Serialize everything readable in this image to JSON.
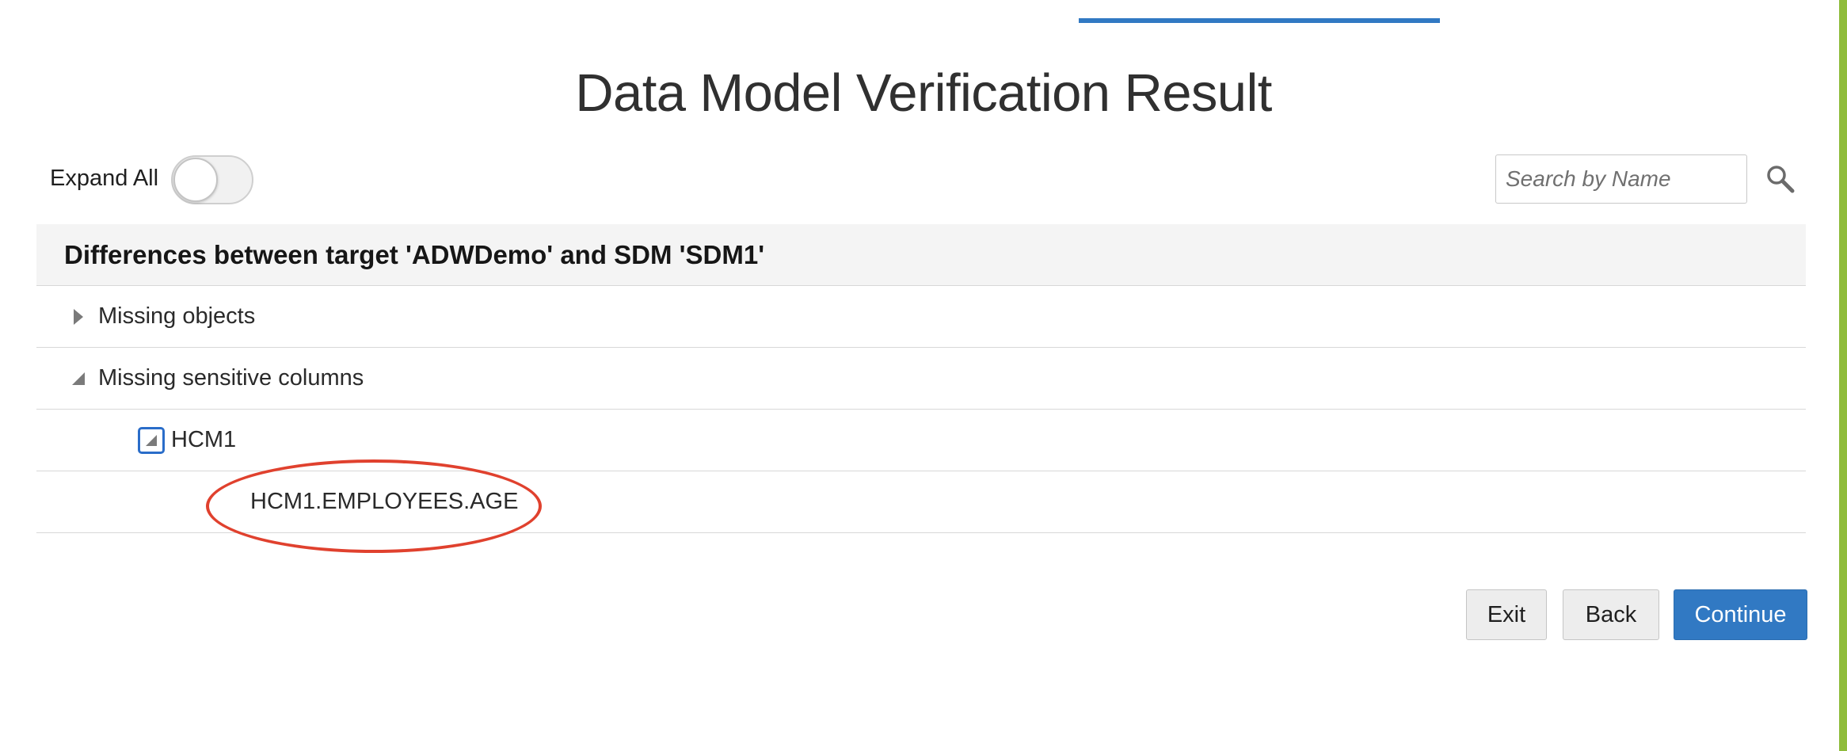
{
  "page": {
    "title": "Data Model Verification Result"
  },
  "toolbar": {
    "expand_all_label": "Expand All",
    "expand_all_on": false,
    "search_placeholder": "Search by Name",
    "search_value": ""
  },
  "table": {
    "header": "Differences between target 'ADWDemo' and SDM 'SDM1'",
    "rows": [
      {
        "label": "Missing objects",
        "expanded": false
      },
      {
        "label": "Missing sensitive columns",
        "expanded": true
      },
      {
        "label": "HCM1",
        "expanded": true,
        "focused": true
      },
      {
        "label": "HCM1.EMPLOYEES.AGE",
        "highlighted": true
      }
    ]
  },
  "actions": {
    "exit_label": "Exit",
    "back_label": "Back",
    "continue_label": "Continue"
  },
  "colors": {
    "accent": "#3179c3",
    "side_bar": "#8fbc3c",
    "annotation": "#e0412e"
  },
  "icons": {
    "search": "search-icon",
    "collapsed": "caret-right-icon",
    "expanded": "caret-down-right-icon"
  }
}
